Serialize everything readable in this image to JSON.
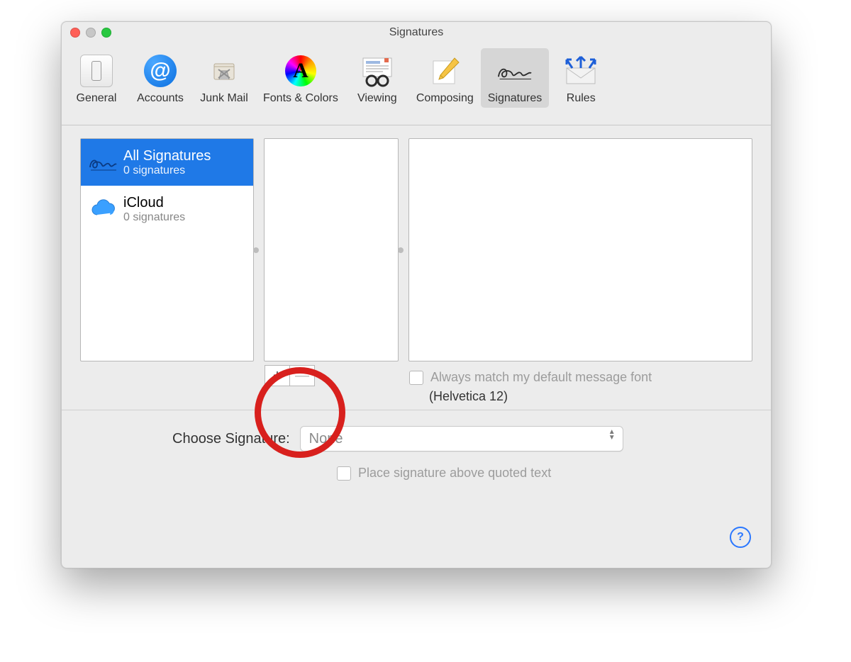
{
  "window": {
    "title": "Signatures"
  },
  "toolbar": {
    "items": [
      {
        "label": "General"
      },
      {
        "label": "Accounts"
      },
      {
        "label": "Junk Mail"
      },
      {
        "label": "Fonts & Colors"
      },
      {
        "label": "Viewing"
      },
      {
        "label": "Composing"
      },
      {
        "label": "Signatures"
      },
      {
        "label": "Rules"
      }
    ],
    "selected_index": 6
  },
  "accounts_panel": {
    "rows": [
      {
        "title": "All Signatures",
        "subtitle": "0 signatures",
        "selected": true,
        "icon": "signature"
      },
      {
        "title": "iCloud",
        "subtitle": "0 signatures",
        "selected": false,
        "icon": "icloud"
      }
    ]
  },
  "add_remove": {
    "add": "+",
    "remove": "—"
  },
  "match_font": {
    "checkbox_label": "Always match my default message font",
    "font": "(Helvetica 12)"
  },
  "choose_signature": {
    "label": "Choose Signature:",
    "selected": "None"
  },
  "place_above": {
    "label": "Place signature above quoted text"
  },
  "help": {
    "symbol": "?"
  }
}
